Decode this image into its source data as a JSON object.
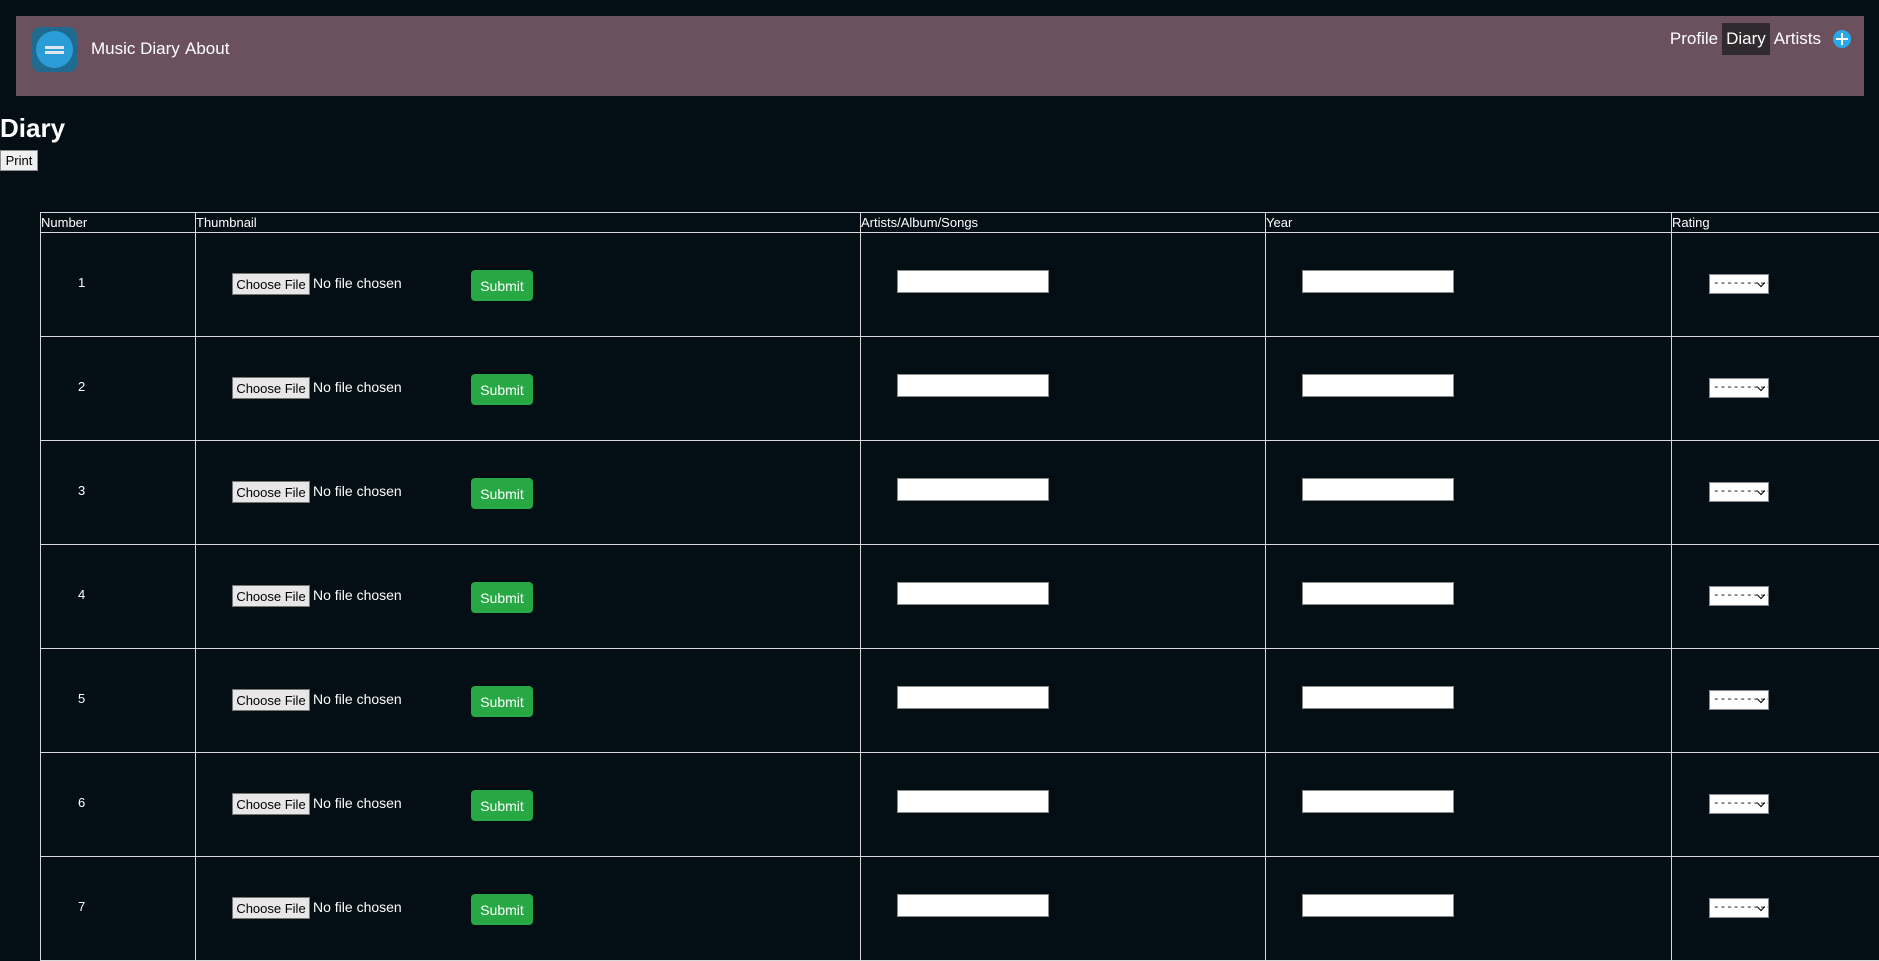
{
  "navbar": {
    "brand": "Music Diary",
    "about": "About",
    "links": [
      {
        "label": "Profile",
        "active": false
      },
      {
        "label": "Diary",
        "active": true
      },
      {
        "label": "Artists",
        "active": false
      }
    ],
    "logo_icon": "music-diary-logo-icon",
    "add_icon": "plus-circle-icon",
    "colors": {
      "navbar_bg": "#6b515d",
      "page_bg": "#040e15",
      "submit": "#28a745"
    }
  },
  "page": {
    "title": "Diary",
    "print_label": "Print"
  },
  "table": {
    "headers": [
      "Number",
      "Thumbnail",
      "Artists/Album/Songs",
      "Year",
      "Rating"
    ],
    "choose_file_label": "Choose File",
    "no_file_text": "No file chosen",
    "submit_label": "Submit",
    "rating_placeholder": "---------",
    "rows": [
      {
        "number": "1",
        "artist_value": "",
        "year_value": ""
      },
      {
        "number": "2",
        "artist_value": "",
        "year_value": ""
      },
      {
        "number": "3",
        "artist_value": "",
        "year_value": ""
      },
      {
        "number": "4",
        "artist_value": "",
        "year_value": ""
      },
      {
        "number": "5",
        "artist_value": "",
        "year_value": ""
      },
      {
        "number": "6",
        "artist_value": "",
        "year_value": ""
      },
      {
        "number": "7",
        "artist_value": "",
        "year_value": ""
      }
    ]
  }
}
